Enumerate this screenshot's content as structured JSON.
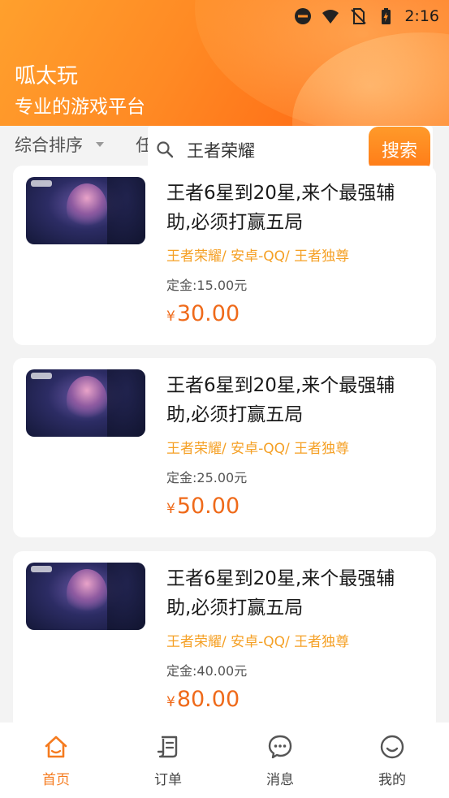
{
  "status_bar": {
    "time": "2:16"
  },
  "header": {
    "title": "呱太玩",
    "subtitle": "专业的游戏平台"
  },
  "filter": {
    "sort_label": "综合排序",
    "other_label": "任"
  },
  "search": {
    "value": "王者荣耀",
    "button_label": "搜索"
  },
  "listings": [
    {
      "title": "王者6星到20星,来个最强辅助,必须打赢五局",
      "tags": "王者荣耀/ 安卓-QQ/ 王者独尊",
      "deposit": "定金:15.00元",
      "currency": "¥",
      "price": "30.00"
    },
    {
      "title": "王者6星到20星,来个最强辅助,必须打赢五局",
      "tags": "王者荣耀/ 安卓-QQ/ 王者独尊",
      "deposit": "定金:25.00元",
      "currency": "¥",
      "price": "50.00"
    },
    {
      "title": "王者6星到20星,来个最强辅助,必须打赢五局",
      "tags": "王者荣耀/ 安卓-QQ/ 王者独尊",
      "deposit": "定金:40.00元",
      "currency": "¥",
      "price": "80.00"
    }
  ],
  "tabbar": {
    "items": [
      {
        "label": "首页",
        "icon": "home-icon",
        "active": true
      },
      {
        "label": "订单",
        "icon": "order-icon",
        "active": false
      },
      {
        "label": "消息",
        "icon": "message-icon",
        "active": false
      },
      {
        "label": "我的",
        "icon": "profile-icon",
        "active": false
      }
    ]
  },
  "colors": {
    "accent": "#ff7a17",
    "price": "#ef6a1a",
    "tag": "#f5a025"
  }
}
